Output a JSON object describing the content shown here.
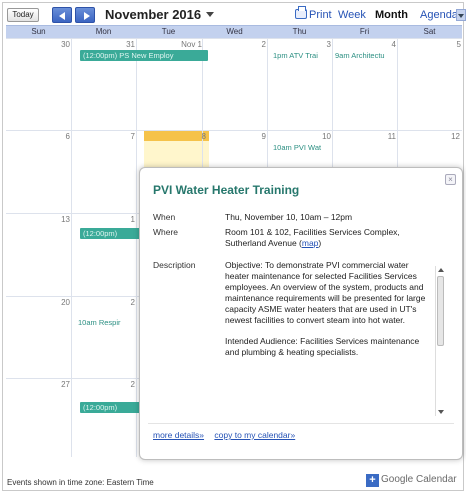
{
  "toolbar": {
    "today_label": "Today",
    "month_label": "November 2016",
    "print_label": "Print",
    "views": {
      "week": "Week",
      "month": "Month",
      "agenda": "Agenda"
    }
  },
  "weekdays": [
    "Sun",
    "Mon",
    "Tue",
    "Wed",
    "Thu",
    "Fri",
    "Sat"
  ],
  "calendar": {
    "day_numbers": {
      "r1": [
        "30",
        "31",
        "Nov 1",
        "2",
        "3",
        "4",
        "5"
      ],
      "r2": [
        "6",
        "7",
        "8",
        "9",
        "10",
        "11",
        "12"
      ],
      "r3": [
        "13",
        "1"
      ],
      "r4": [
        "20",
        "2"
      ],
      "r5": [
        "27",
        "2"
      ]
    },
    "events": {
      "e1": "(12:00pm) PS New Employ",
      "e2": "1pm ATV Trai",
      "e3": "9am Architectu",
      "e4": "10am PVI Wat",
      "e5": "(12:00pm)",
      "e6": "10am Respir",
      "e7": "(12:00pm)"
    }
  },
  "popup": {
    "title": "PVI Water Heater Training",
    "when_label": "When",
    "when_value": "Thu, November 10, 10am – 12pm",
    "where_label": "Where",
    "where_value": "Room 101 & 102, Facilities Services Complex, Sutherland Avenue (",
    "map_link": "map",
    "where_close": ")",
    "description_label": "Description",
    "description_p1": "Objective: To demonstrate PVI commercial water heater maintenance for selected Facilities Services employees. An overview of the system, products and maintenance requirements will be presented for large capacity ASME water heaters that are used in UT's newest facilities to convert steam into hot water.",
    "description_p2": "Intended Audience: Facilities Services maintenance and plumbing & heating specialists.",
    "more_details": "more details»",
    "copy_calendar": "copy to my calendar»"
  },
  "footer": {
    "timezone": "Events shown in time zone: Eastern Time",
    "brand": "Google Calendar"
  },
  "colors": {
    "event_teal": "#3aaa98",
    "title_teal": "#26776c",
    "today_highlight": "#f5c24a",
    "header_blue": "#c3d1ee",
    "link_blue": "#2552b5"
  }
}
